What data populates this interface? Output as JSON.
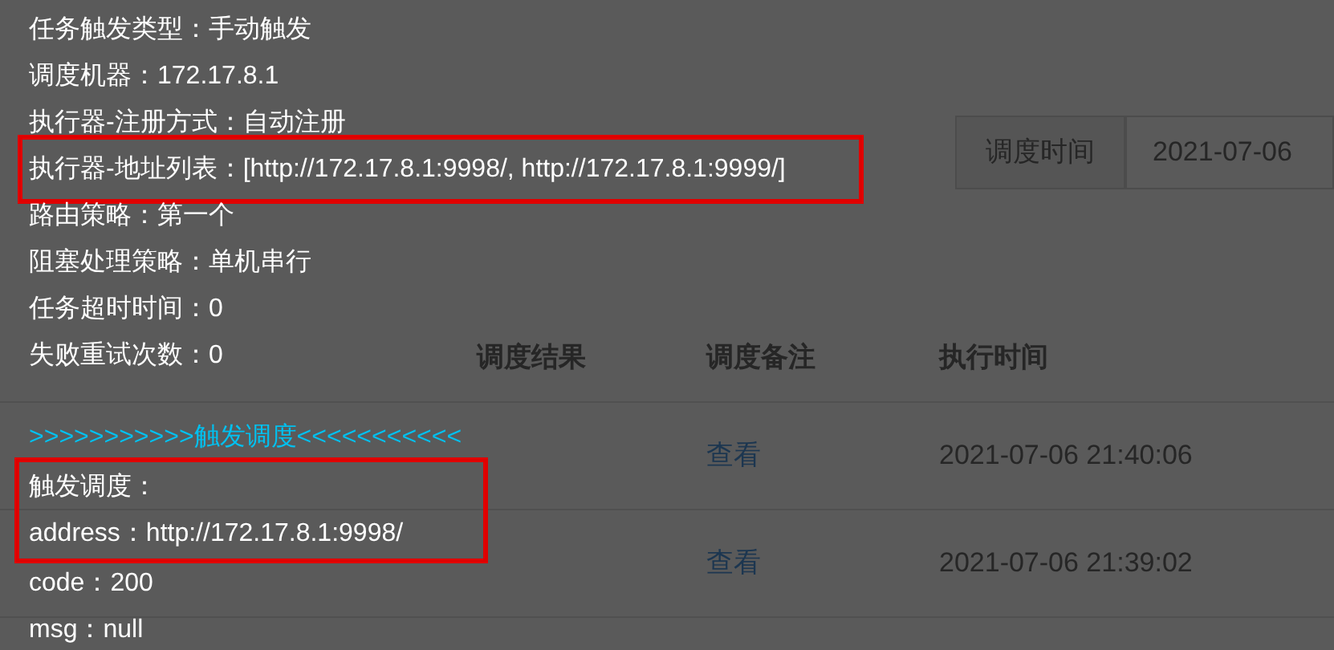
{
  "filters": [
    {
      "kind": "label",
      "text": "调度时间"
    },
    {
      "kind": "field",
      "text": "2021-07-06"
    }
  ],
  "table": {
    "columns": [
      {
        "label": "调度结果"
      },
      {
        "label": "调度备注"
      },
      {
        "label": "执行时间"
      }
    ],
    "rows": [
      {
        "remark_link": "查看",
        "exec_time": "2021-07-06 21:40:06"
      },
      {
        "remark_link": "查看",
        "exec_time": "2021-07-06 21:39:02"
      }
    ]
  },
  "tooltip": {
    "trigger_info": [
      {
        "text": "任务触发类型：手动触发",
        "highlighted": false
      },
      {
        "text": "调度机器：172.17.8.1",
        "highlighted": false
      },
      {
        "text": "执行器-注册方式：自动注册",
        "highlighted": false
      },
      {
        "text": "执行器-地址列表：[http://172.17.8.1:9998/, http://172.17.8.1:9999/]",
        "highlighted": true
      },
      {
        "text": "路由策略：第一个",
        "highlighted": false
      },
      {
        "text": "阻塞处理策略：单机串行",
        "highlighted": false
      },
      {
        "text": "任务超时时间：0",
        "highlighted": false
      },
      {
        "text": "失败重试次数：0",
        "highlighted": false
      }
    ],
    "section_header": ">>>>>>>>>>>触发调度<<<<<<<<<<<",
    "trigger_result": {
      "highlighted": true,
      "lines": [
        "触发调度：",
        "address：http://172.17.8.1:9998/"
      ]
    },
    "result_details": [
      "code：200",
      "msg：null"
    ]
  }
}
